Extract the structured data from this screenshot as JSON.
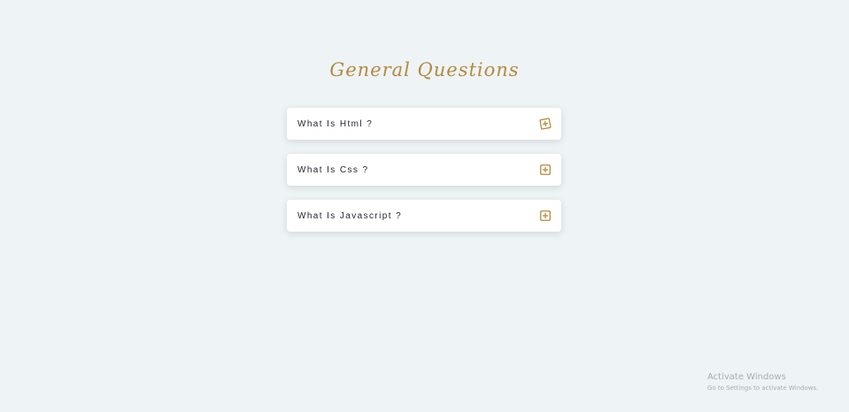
{
  "page": {
    "title": "General Questions"
  },
  "faq": {
    "items": [
      {
        "question": "What Is Html ?",
        "icon": "plus-square-icon"
      },
      {
        "question": "What Is Css ?",
        "icon": "plus-square-icon"
      },
      {
        "question": "What Is Javascript ?",
        "icon": "plus-square-icon"
      }
    ]
  },
  "watermark": {
    "title": "Activate Windows",
    "subtitle": "Go to Settings to activate Windows."
  },
  "colors": {
    "background": "#eef3f6",
    "accent": "#b48a3d",
    "card": "#ffffff",
    "text": "#222733"
  }
}
